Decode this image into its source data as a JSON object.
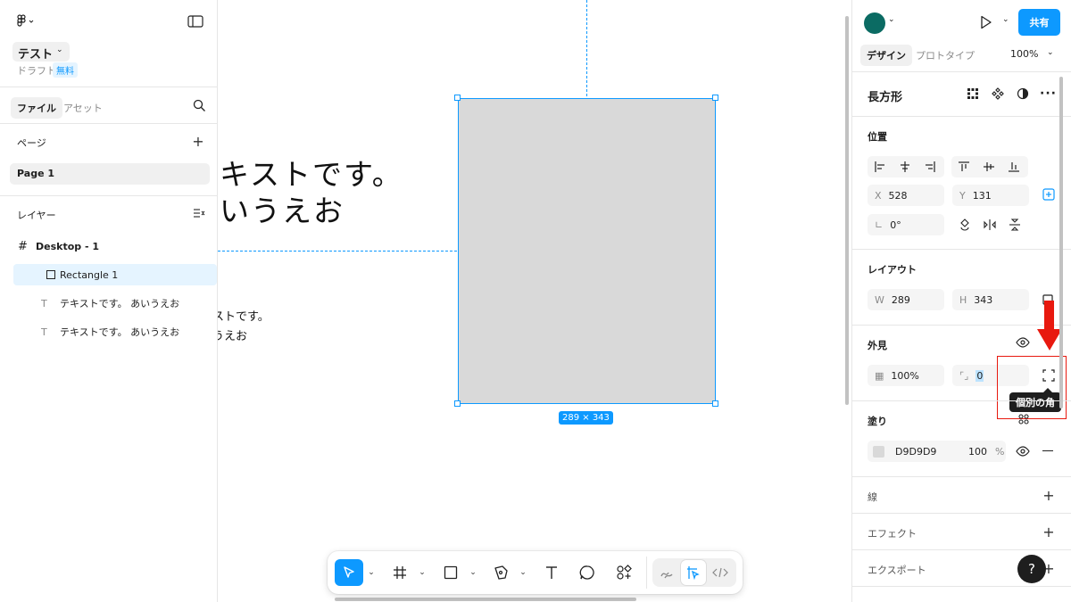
{
  "left_panel": {
    "file_name": "テスト",
    "file_sub": "ドラフト",
    "plan_badge": "無料",
    "tabs": [
      "ファイル",
      "アセット"
    ],
    "pages_label": "ページ",
    "pages": [
      "Page 1"
    ],
    "layers_label": "レイヤー",
    "layers": [
      {
        "name": "Desktop - 1",
        "icon": "frame-icon"
      },
      {
        "name": "Rectangle 1",
        "icon": "rectangle-icon"
      },
      {
        "name": "テキストです。 あいうえお",
        "icon": "text-icon"
      },
      {
        "name": "テキストです。 あいうえお",
        "icon": "text-icon"
      }
    ]
  },
  "canvas": {
    "big_text_line1": "キストです。",
    "big_text_line2": "いうえお",
    "small_text_line1": "ストです。",
    "small_text_line2": "うえお",
    "size_badge": "289 × 343",
    "rect_fill": "#D9D9D9",
    "selection_color": "#0d99ff"
  },
  "toolbar": {
    "tools": [
      "move-tool",
      "frame-tool",
      "rectangle-tool",
      "pen-tool",
      "text-tool",
      "comment-tool",
      "actions-tool"
    ],
    "modes": [
      "draw-mode",
      "design-mode",
      "dev-mode"
    ]
  },
  "right_panel": {
    "share_label": "共有",
    "tabs": [
      "デザイン",
      "プロトタイプ"
    ],
    "zoom": "100%",
    "selection_type": "長方形",
    "position_label": "位置",
    "x_label": "X",
    "x_value": "528",
    "y_label": "Y",
    "y_value": "131",
    "rotation_value": "0°",
    "layout_label": "レイアウト",
    "w_label": "W",
    "w_value": "289",
    "h_label": "H",
    "h_value": "343",
    "appearance_label": "外見",
    "opacity_value": "100%",
    "radius_value": "0",
    "tooltip": "個別の角",
    "fill_label": "塗り",
    "fill_hex": "D9D9D9",
    "fill_opacity": "100",
    "fill_percent": "%",
    "stroke_label": "線",
    "effects_label": "エフェクト",
    "export_label": "エクスポート",
    "help_label": "?",
    "avatar_color": "#0b6b63",
    "accent": "#0d99ff",
    "annotation_color": "#e8190f"
  }
}
